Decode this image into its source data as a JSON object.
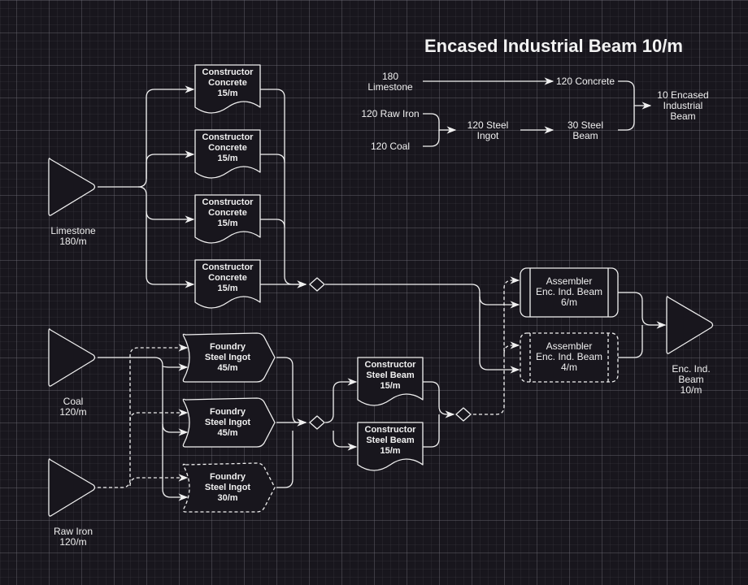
{
  "title": "Encased Industrial Beam 10/m",
  "colors": {
    "background": "#18161d",
    "stroke": "#f0f0f0",
    "text": "#f0f0f0"
  },
  "summary": {
    "limestone": "180\nLimestone",
    "raw_iron": "120 Raw Iron",
    "coal": "120 Coal",
    "steel_ingot": "120 Steel\nIngot",
    "concrete": "120 Concrete",
    "steel_beam": "30 Steel\nBeam",
    "output": "10 Encased\nIndustrial\nBeam"
  },
  "sources": [
    {
      "id": "limestone",
      "label": "Limestone\n180/m"
    },
    {
      "id": "coal",
      "label": "Coal\n120/m"
    },
    {
      "id": "raw_iron",
      "label": "Raw Iron\n120/m"
    }
  ],
  "output_node": {
    "label": "Enc. Ind.\nBeam\n10/m"
  },
  "concrete_constructors": [
    {
      "label": "Constructor\nConcrete\n15/m"
    },
    {
      "label": "Constructor\nConcrete\n15/m"
    },
    {
      "label": "Constructor\nConcrete\n15/m"
    },
    {
      "label": "Constructor\nConcrete\n15/m"
    }
  ],
  "foundries": [
    {
      "label": "Foundry\nSteel Ingot\n45/m",
      "dashed": false
    },
    {
      "label": "Foundry\nSteel Ingot\n45/m",
      "dashed": false
    },
    {
      "label": "Foundry\nSteel Ingot\n30/m",
      "dashed": true
    }
  ],
  "beam_constructors": [
    {
      "label": "Constructor\nSteel Beam\n15/m"
    },
    {
      "label": "Constructor\nSteel Beam\n15/m"
    }
  ],
  "assemblers": [
    {
      "label": "Assembler\nEnc. Ind. Beam\n6/m",
      "dashed": false
    },
    {
      "label": "Assembler\nEnc. Ind. Beam\n4/m",
      "dashed": true
    }
  ]
}
